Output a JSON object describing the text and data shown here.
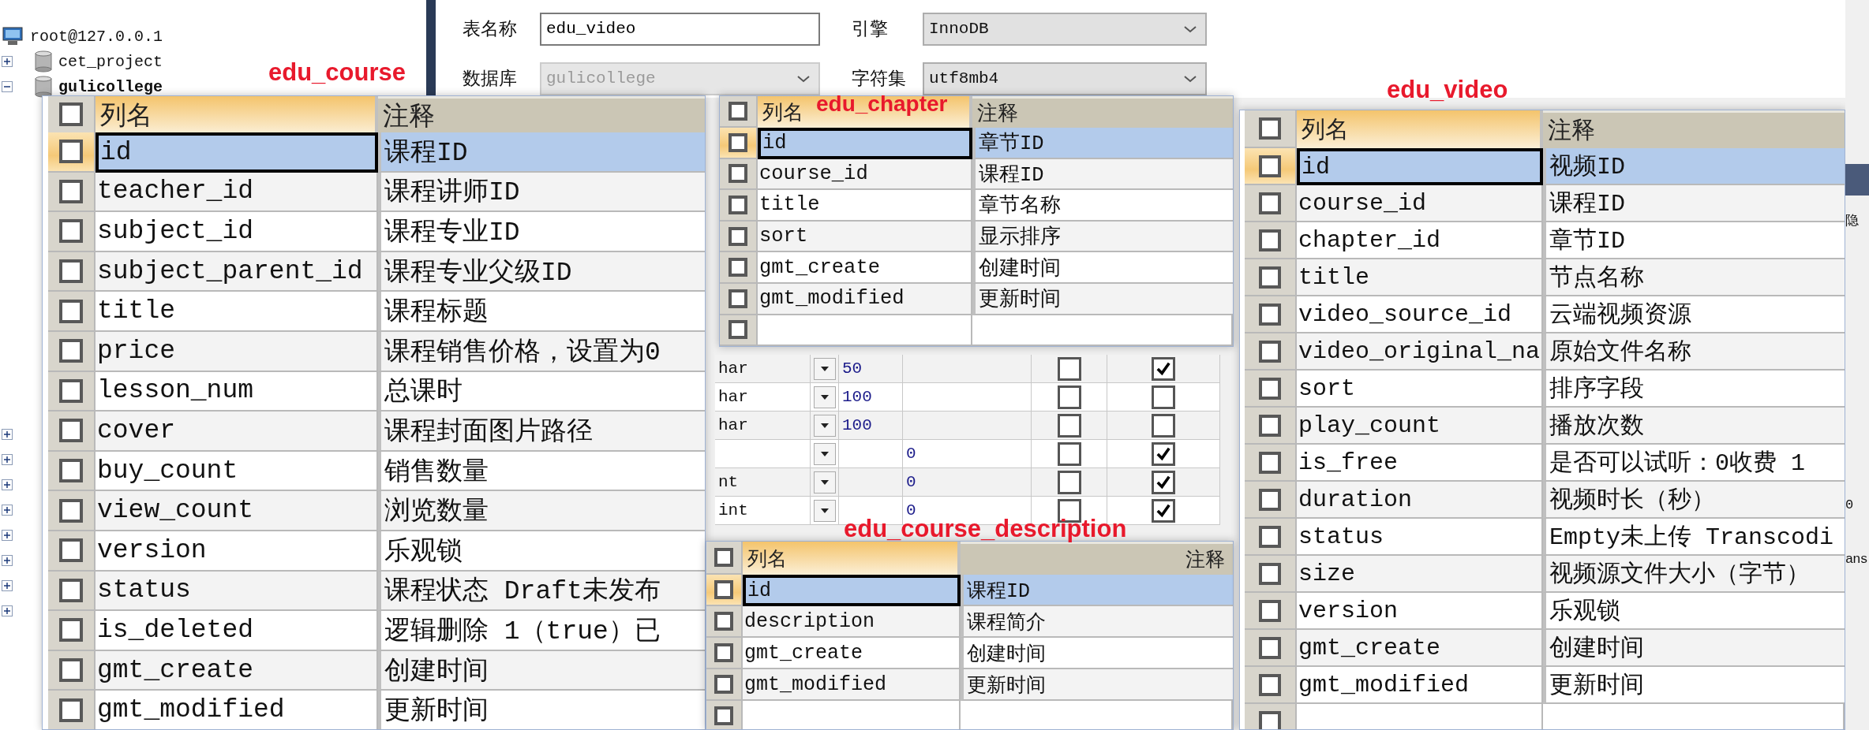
{
  "form": {
    "table_name_label": "表名称",
    "table_name": "edu_video",
    "engine_label": "引擎",
    "engine": "InnoDB",
    "database_label": "数据库",
    "database": "gulicollege",
    "charset_label": "字符集",
    "charset": "utf8mb4"
  },
  "tree": {
    "label": "root@127.0.0.1",
    "children": [
      {
        "label": "cet_project",
        "expanded": false,
        "bold": false
      },
      {
        "label": "gulicollege",
        "expanded": true,
        "bold": true
      }
    ]
  },
  "covered_nodes": [
    {
      "expanded": false
    },
    {
      "expanded": false
    },
    {
      "expanded": false
    },
    {
      "expanded": false
    },
    {
      "expanded": false
    },
    {
      "expanded": false
    },
    {
      "expanded": false
    },
    {
      "expanded": false
    }
  ],
  "background_grid": [
    {
      "type": "har",
      "length": "50",
      "not_null": false,
      "flag": true
    },
    {
      "type": "har",
      "length": "100",
      "not_null": false,
      "flag": false
    },
    {
      "type": "har",
      "length": "100",
      "not_null": false,
      "flag": false
    },
    {
      "default": "0",
      "not_null": false,
      "flag": true
    },
    {
      "type": "nt",
      "default": "0",
      "not_null": false,
      "flag": true
    },
    {
      "type": "int",
      "default": "0",
      "not_null": false,
      "flag": true
    }
  ],
  "right_edge": [
    "隐",
    "0",
    "ans"
  ],
  "panels": [
    {
      "label": "edu_course",
      "header": {
        "name": "列名",
        "comment": "注释",
        "checked": false
      },
      "rows": [
        {
          "name": "id",
          "comment": "课程ID",
          "selected": true,
          "checked": false
        },
        {
          "name": "teacher_id",
          "comment": "课程讲师ID",
          "selected": false,
          "checked": false
        },
        {
          "name": "subject_id",
          "comment": "课程专业ID",
          "selected": false,
          "checked": false
        },
        {
          "name": "subject_parent_id",
          "comment": "课程专业父级ID",
          "selected": false,
          "checked": false
        },
        {
          "name": "title",
          "comment": "课程标题",
          "selected": false,
          "checked": false
        },
        {
          "name": "price",
          "comment": "课程销售价格，设置为0",
          "selected": false,
          "checked": false
        },
        {
          "name": "lesson_num",
          "comment": "总课时",
          "selected": false,
          "checked": false
        },
        {
          "name": "cover",
          "comment": "课程封面图片路径",
          "selected": false,
          "checked": false
        },
        {
          "name": "buy_count",
          "comment": "销售数量",
          "selected": false,
          "checked": false
        },
        {
          "name": "view_count",
          "comment": "浏览数量",
          "selected": false,
          "checked": false
        },
        {
          "name": "version",
          "comment": "乐观锁",
          "selected": false,
          "checked": false
        },
        {
          "name": "status",
          "comment": "课程状态 Draft未发布",
          "selected": false,
          "checked": false
        },
        {
          "name": "is_deleted",
          "comment": "逻辑删除 1（true）已",
          "selected": false,
          "checked": false
        },
        {
          "name": "gmt_create",
          "comment": "创建时间",
          "selected": false,
          "checked": false
        },
        {
          "name": "gmt_modified",
          "comment": "更新时间",
          "selected": false,
          "checked": false
        }
      ]
    },
    {
      "label": "edu_chapter",
      "header": {
        "name": "列名",
        "comment": "注释",
        "checked": false
      },
      "rows": [
        {
          "name": "id",
          "comment": "章节ID",
          "selected": true,
          "checked": false
        },
        {
          "name": "course_id",
          "comment": "课程ID",
          "selected": false,
          "checked": false
        },
        {
          "name": "title",
          "comment": "章节名称",
          "selected": false,
          "checked": false
        },
        {
          "name": "sort",
          "comment": "显示排序",
          "selected": false,
          "checked": false
        },
        {
          "name": "gmt_create",
          "comment": "创建时间",
          "selected": false,
          "checked": false
        },
        {
          "name": "gmt_modified",
          "comment": "更新时间",
          "selected": false,
          "checked": false
        }
      ],
      "blank_row": {
        "checked": false
      }
    },
    {
      "label": "edu_course_description",
      "header": {
        "name": "列名",
        "comment": "注释",
        "checked": false
      },
      "rows": [
        {
          "name": "id",
          "comment": "课程ID",
          "selected": true,
          "checked": false
        },
        {
          "name": "description",
          "comment": "课程简介",
          "selected": false,
          "checked": false
        },
        {
          "name": "gmt_create",
          "comment": "创建时间",
          "selected": false,
          "checked": false
        },
        {
          "name": "gmt_modified",
          "comment": "更新时间",
          "selected": false,
          "checked": false
        }
      ],
      "blank_row": {
        "checked": false
      }
    },
    {
      "label": "edu_video",
      "header": {
        "name": "列名",
        "comment": "注释",
        "checked": false
      },
      "rows": [
        {
          "name": "id",
          "comment": "视频ID",
          "selected": true,
          "checked": false
        },
        {
          "name": "course_id",
          "comment": "课程ID",
          "selected": false,
          "checked": false
        },
        {
          "name": "chapter_id",
          "comment": "章节ID",
          "selected": false,
          "checked": false
        },
        {
          "name": "title",
          "comment": "节点名称",
          "selected": false,
          "checked": false
        },
        {
          "name": "video_source_id",
          "comment": "云端视频资源",
          "selected": false,
          "checked": false
        },
        {
          "name": "video_original_na",
          "comment": "原始文件名称",
          "selected": false,
          "checked": false
        },
        {
          "name": "sort",
          "comment": "排序字段",
          "selected": false,
          "checked": false
        },
        {
          "name": "play_count",
          "comment": "播放次数",
          "selected": false,
          "checked": false
        },
        {
          "name": "is_free",
          "comment": "是否可以试听：0收费 1",
          "selected": false,
          "checked": false
        },
        {
          "name": "duration",
          "comment": "视频时长（秒）",
          "selected": false,
          "checked": false
        },
        {
          "name": "status",
          "comment": "Empty未上传 Transcodi",
          "selected": false,
          "checked": false
        },
        {
          "name": "size",
          "comment": "视频源文件大小（字节）",
          "selected": false,
          "checked": false
        },
        {
          "name": "version",
          "comment": "乐观锁",
          "selected": false,
          "checked": false
        },
        {
          "name": "gmt_create",
          "comment": "创建时间",
          "selected": false,
          "checked": false
        },
        {
          "name": "gmt_modified",
          "comment": "更新时间",
          "selected": false,
          "checked": false
        }
      ],
      "blank_row": {
        "checked": false
      }
    }
  ]
}
